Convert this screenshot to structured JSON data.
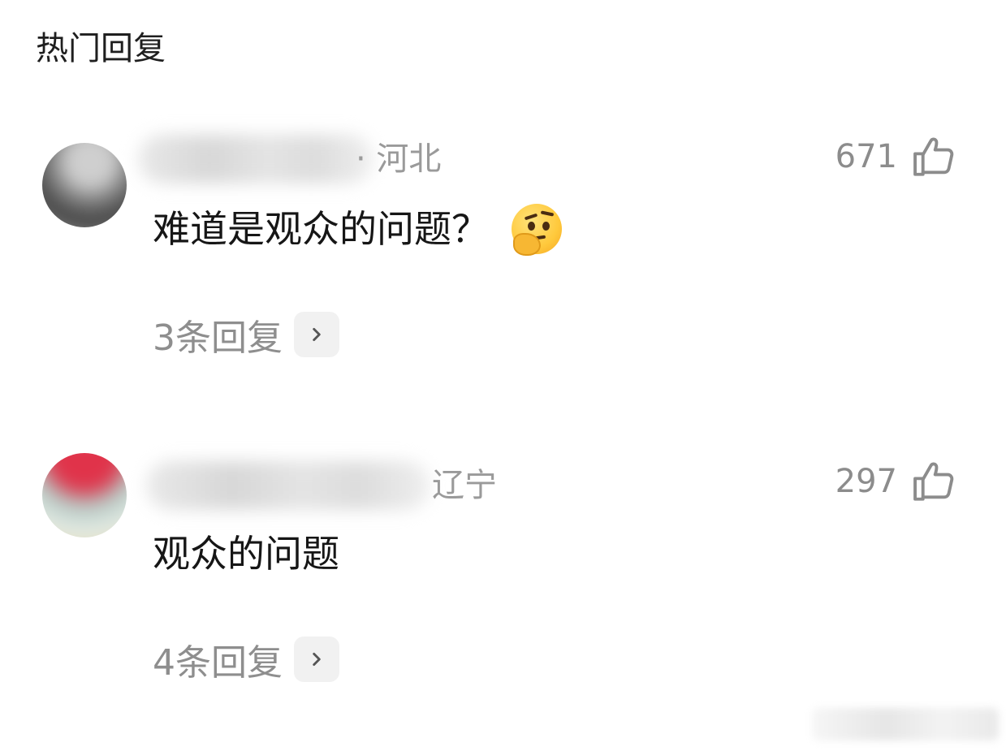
{
  "section": {
    "title": "热门回复"
  },
  "comments": [
    {
      "location": "· 河北",
      "like_count": "671",
      "text": "难道是观众的问题？",
      "has_emoji": "thinking-face",
      "replies_label": "3条回复"
    },
    {
      "location": "辽宁",
      "like_count": "297",
      "text": "观众的问题",
      "replies_label": "4条回复"
    }
  ],
  "colors": {
    "muted_text": "#9a9a9a",
    "body_text": "#161616",
    "chevron_bg": "#f1f1f1"
  }
}
